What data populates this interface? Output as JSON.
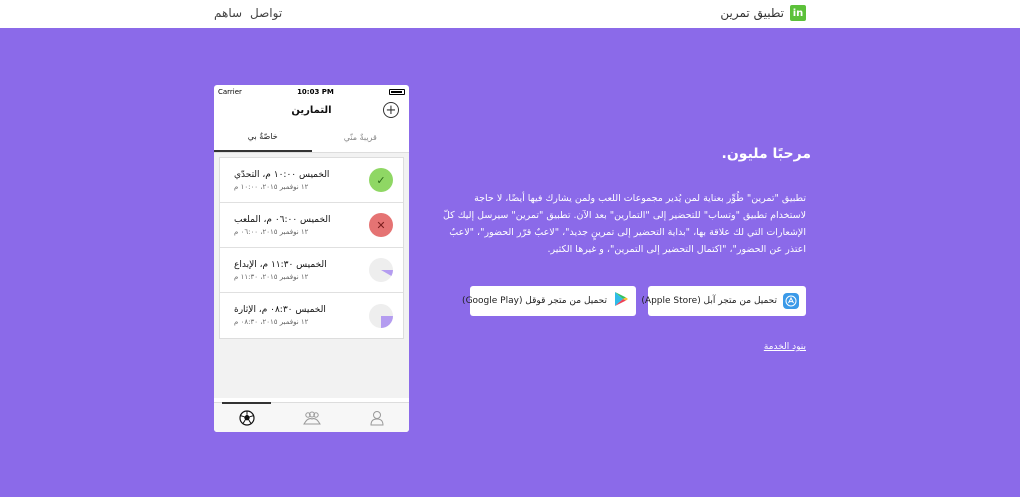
{
  "header": {
    "brand_name": "تطبيق تمرين",
    "brand_logo_letter": "in",
    "nav": [
      "تواصل",
      "ساهم"
    ]
  },
  "phone": {
    "status_bar": {
      "carrier": "Carrier",
      "time": "10:03 PM"
    },
    "title": "التمارين",
    "tabs": [
      "خاصّةٌ بي",
      "قريبةٌ منّي"
    ],
    "items": [
      {
        "title": "الخميس ١٠:٠٠ م، التحدّي",
        "subtitle": "١٢ نوفمبر ٢٠١٥، ١٠:٠٠ م",
        "status": "confirmed",
        "status_icon": "check-icon"
      },
      {
        "title": "الخميس ٠٦:٠٠ م، الملعب",
        "subtitle": "١٢ نوفمبر ٢٠١٥، ٠٦:٠٠ م",
        "status": "declined",
        "status_icon": "close-icon"
      },
      {
        "title": "الخميس ١١:٣٠ م، الإبداع",
        "subtitle": "١٢ نوفمبر ٢٠١٥، ١١:٣٠ م",
        "status": "pending",
        "status_icon": "pie-icon"
      },
      {
        "title": "الخميس ٠٨:٣٠ م، الإثارة",
        "subtitle": "١٢ نوفمبر ٢٠١٥، ٠٨:٣٠ م",
        "status": "pending",
        "status_icon": "pie-icon"
      }
    ],
    "tabbar": [
      "ball-icon",
      "group-icon",
      "user-icon"
    ]
  },
  "main": {
    "headline": "مرحبًا مليون.",
    "description": "تطبيق \"تمرين\" طُوِّر بعناية لمن يُدير مجموعات اللعب ولمن يشارك فيها أيضًا، لا حاجة لاستخدام تطبيق \"وتساب\" للتحضير إلى \"التمارين\" بعد الآن. تطبيق \"تمرين\" سيرسل إليك كلّ الإشعارات التي لك علاقة بها، \"بداية التحضير إلى تمرينٍ جديد\"، \"لاعبٌ قرّر الحضور\"، \"لاعبٌ اعتذر عن الحضور\"، \"اكتمال التحضير إلى التمرين\"، و غيرها الكثير.",
    "apple_button": "تحميل من متجر آبل (Apple Store)",
    "google_button": "تحميل من متجر قوقل (Google Play)",
    "terms": "بنود الخدمة"
  },
  "colors": {
    "background": "#8b6ae9",
    "brand_green": "#5cc13a",
    "confirmed": "#8fd764",
    "declined": "#e57373",
    "pending_fill": "#b49cf0"
  }
}
